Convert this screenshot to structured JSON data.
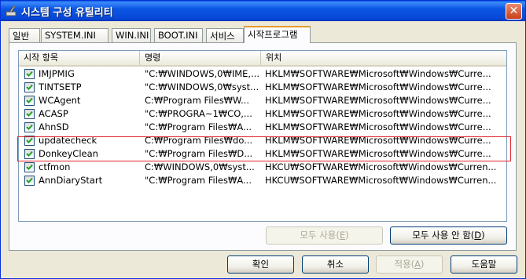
{
  "window": {
    "title": "시스템 구성 유틸리티",
    "close_glyph": "✕"
  },
  "tabs": [
    {
      "label": "일반"
    },
    {
      "label": "SYSTEM.INI"
    },
    {
      "label": "WIN.INI"
    },
    {
      "label": "BOOT.INI"
    },
    {
      "label": "서비스"
    },
    {
      "label": "시작프로그램",
      "active": true
    }
  ],
  "list": {
    "columns": [
      "시작 항목",
      "명령",
      "위치"
    ],
    "rows": [
      {
        "checked": true,
        "item": "IMJPMIG",
        "command": "\"C:₩WINDOWS,0₩IME,...",
        "location": "HKLM₩SOFTWARE₩Microsoft₩Windows₩Curre..."
      },
      {
        "checked": true,
        "item": "TINTSETP",
        "command": "\"C:₩WINDOWS,0₩syst...",
        "location": "HKLM₩SOFTWARE₩Microsoft₩Windows₩Curre..."
      },
      {
        "checked": true,
        "item": "WCAgent",
        "command": "C:₩Program Files₩W...",
        "location": "HKLM₩SOFTWARE₩Microsoft₩Windows₩Curre..."
      },
      {
        "checked": true,
        "item": "ACASP",
        "command": "\"C:₩PROGRA~1₩CO,...",
        "location": "HKLM₩SOFTWARE₩Microsoft₩Windows₩Curre..."
      },
      {
        "checked": true,
        "item": "AhnSD",
        "command": "\"C:₩Program Files₩A...",
        "location": "HKLM₩SOFTWARE₩Microsoft₩Windows₩Curre..."
      },
      {
        "checked": true,
        "item": "updatecheck",
        "command": "C:₩Program Files₩do...",
        "location": "HKLM₩SOFTWARE₩Microsoft₩Windows₩Curre..."
      },
      {
        "checked": true,
        "item": "DonkeyClean",
        "command": "\"C:₩Program Files₩D...",
        "location": "HKLM₩SOFTWARE₩Microsoft₩Windows₩Curre..."
      },
      {
        "checked": true,
        "item": "ctfmon",
        "command": "C:₩WINDOWS,0₩syst...",
        "location": "HKCU₩SOFTWARE₩Microsoft₩Windows₩Curren..."
      },
      {
        "checked": true,
        "item": "AnnDiaryStart",
        "command": "\"C:₩Program Files₩A...",
        "location": "HKCU₩SOFTWARE₩Microsoft₩Windows₩Curren..."
      }
    ]
  },
  "panel_buttons": {
    "enable_all": {
      "text": "모두 사용(",
      "key": "E",
      "tail": ")",
      "disabled": true
    },
    "disable_all": {
      "text": "모두 사용 안 함(",
      "key": "D",
      "tail": ")"
    }
  },
  "dialog_buttons": {
    "ok": {
      "text": "확인"
    },
    "cancel": {
      "text": "취소"
    },
    "apply": {
      "text": "적용(",
      "key": "A",
      "tail": ")",
      "disabled": true
    },
    "help": {
      "text": "도움말"
    }
  },
  "colors": {
    "titlebar": "#0b55e3",
    "highlight_box": "#e0242b",
    "check": "#21a121"
  }
}
